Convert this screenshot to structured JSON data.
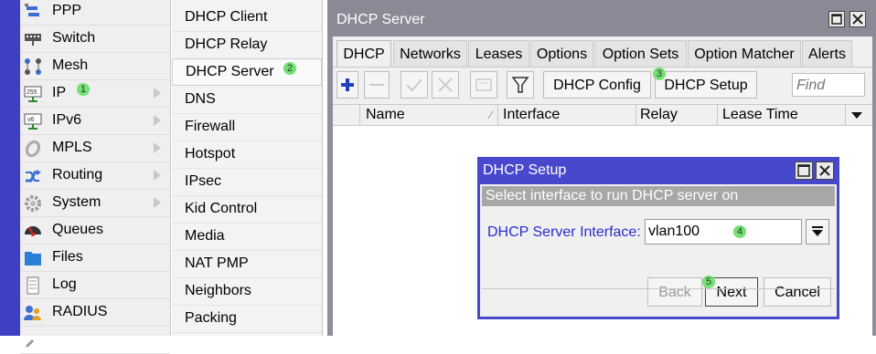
{
  "menu": {
    "items": [
      {
        "label": "PPP",
        "icon": "ppp-icon",
        "arrow": false
      },
      {
        "label": "Switch",
        "icon": "switch-icon",
        "arrow": false
      },
      {
        "label": "Mesh",
        "icon": "mesh-icon",
        "arrow": false
      },
      {
        "label": "IP",
        "icon": "ip-icon",
        "arrow": true,
        "step": "1"
      },
      {
        "label": "IPv6",
        "icon": "ipv6-icon",
        "arrow": true
      },
      {
        "label": "MPLS",
        "icon": "mpls-icon",
        "arrow": true
      },
      {
        "label": "Routing",
        "icon": "routing-icon",
        "arrow": true
      },
      {
        "label": "System",
        "icon": "system-gear-icon",
        "arrow": true
      },
      {
        "label": "Queues",
        "icon": "queues-icon",
        "arrow": false
      },
      {
        "label": "Files",
        "icon": "folder-icon",
        "arrow": false
      },
      {
        "label": "Log",
        "icon": "log-icon",
        "arrow": false
      },
      {
        "label": "RADIUS",
        "icon": "radius-icon",
        "arrow": false
      }
    ]
  },
  "submenu": {
    "items": [
      {
        "label": "DHCP Client"
      },
      {
        "label": "DHCP Relay"
      },
      {
        "label": "DHCP Server",
        "selected": true,
        "step": "2"
      },
      {
        "label": "DNS"
      },
      {
        "label": "Firewall"
      },
      {
        "label": "Hotspot"
      },
      {
        "label": "IPsec"
      },
      {
        "label": "Kid Control"
      },
      {
        "label": "Media"
      },
      {
        "label": "NAT PMP"
      },
      {
        "label": "Neighbors"
      },
      {
        "label": "Packing"
      }
    ]
  },
  "server_window": {
    "title": "DHCP Server",
    "tabs": [
      "DHCP",
      "Networks",
      "Leases",
      "Options",
      "Option Sets",
      "Option Matcher",
      "Alerts"
    ],
    "active_tab": "DHCP",
    "toolbar": {
      "dhcp_config_label": "DHCP Config",
      "dhcp_setup_label": "DHCP Setup",
      "dhcp_setup_step": "3",
      "find_placeholder": "Find"
    },
    "columns": [
      "Name",
      "Interface",
      "Relay",
      "Lease Time"
    ]
  },
  "setup_dialog": {
    "title": "DHCP Setup",
    "hint": "Select interface to run DHCP server on",
    "interface_label": "DHCP Server Interface:",
    "interface_value": "vlan100",
    "interface_step": "4",
    "back_label": "Back",
    "next_label": "Next",
    "next_step": "5",
    "cancel_label": "Cancel"
  },
  "colors": {
    "menu_strip": "#3f3fc4",
    "dialog_title": "#4848cc",
    "window_title": "#8a8a96",
    "step_badge": "#74e074",
    "label_blue": "#2b2bd0"
  }
}
